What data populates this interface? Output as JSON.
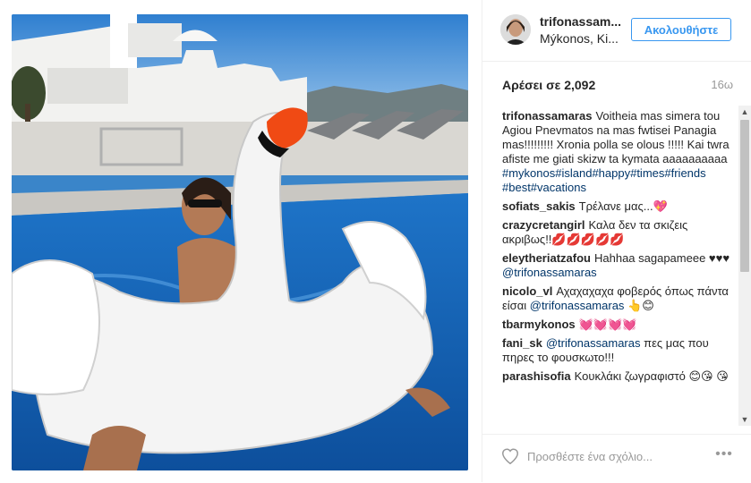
{
  "post": {
    "username": "trifonassam...",
    "location": "Μýkonos, Ki...",
    "follow_label": "Ακολουθήστε",
    "likes": "Αρέσει σε 2,092",
    "time": "16ω"
  },
  "comments": [
    {
      "user": "trifonassamaras",
      "text": "Voitheia mas simera tou Agiou Pnevmatos na mas fwtisei Panagia mas!!!!!!!!! Xronia polla se olous !!!!! Kai twra afiste me giati skizw ta kymata aaaaaaaaaa",
      "tags": "#mykonos#island#happy#times#friends #best#vacations"
    },
    {
      "user": "sofiats_sakis",
      "text": "Τρέλανε μας...💖",
      "tags": ""
    },
    {
      "user": "crazycretangirl",
      "text": "Καλα δεν τα σκιζεις ακριβως!!💋💋💋💋💋",
      "tags": ""
    },
    {
      "user": "eleytheriatzafou",
      "text": "Hahhaa sagapameee ♥♥♥",
      "tags": "@trifonassamaras"
    },
    {
      "user": "nicolo_vl",
      "text": "Αχαχαχαχα φοβερός όπως πάντα είσαι",
      "tags": "@trifonassamaras",
      "after": "👆😊"
    },
    {
      "user": "tbarmykonos",
      "text": "💓💓💓💓",
      "tags": ""
    },
    {
      "user": "fani_sk",
      "text": "πες μας που πηρες το φουσκωτο!!!",
      "pre_tag": "@trifonassamaras"
    },
    {
      "user": "parashisofia",
      "text": "Κουκλάκι ζωγραφιστό 😊😘 😘",
      "tags": ""
    }
  ],
  "comment_box": {
    "placeholder": "Προσθέστε ένα σχόλιο...",
    "more_label": "•••"
  },
  "icons": {
    "heart": "heart-outline-icon",
    "more": "more-options-icon",
    "scroll_up": "scroll-up-arrow-icon",
    "scroll_down": "scroll-down-arrow-icon"
  },
  "colors": {
    "accent": "#3897f0",
    "link": "#003569",
    "border": "#efefef"
  }
}
